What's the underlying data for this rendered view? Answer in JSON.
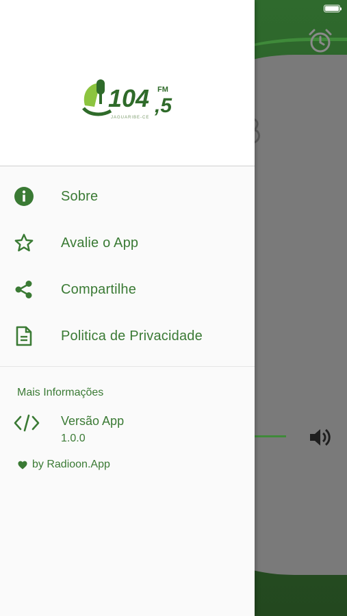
{
  "colors": {
    "accent": "#3a7a34",
    "drawer_bg": "#fafafa",
    "backdrop_green": "#2b5b2a"
  },
  "logo": {
    "number": "104",
    "decimal": ",5",
    "unit": "FM",
    "location": "JAGUARIBE-CE",
    "icon": "microphone-logo-icon"
  },
  "menu": {
    "items": [
      {
        "label": "Sobre",
        "icon": "info-icon"
      },
      {
        "label": "Avalie o App",
        "icon": "star-icon"
      },
      {
        "label": "Compartilhe",
        "icon": "share-icon"
      },
      {
        "label": "Politica de Privacidade",
        "icon": "document-icon"
      }
    ]
  },
  "info": {
    "title": "Mais Informações",
    "version_label": "Versão App",
    "version_value": "1.0.0",
    "version_icon": "code-icon",
    "credit": "by Radioon.App",
    "credit_icon": "heart-icon"
  },
  "background": {
    "alarm_icon": "alarm-clock-icon",
    "volume_icon": "volume-icon"
  }
}
